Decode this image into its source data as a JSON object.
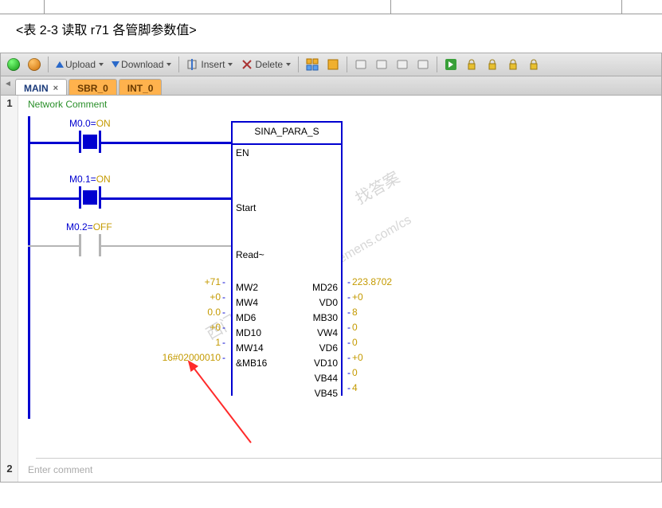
{
  "doc_caption": "<表 2-3 读取 r71 各管脚参数值>",
  "toolbar": {
    "upload": "Upload",
    "download": "Download",
    "insert": "Insert",
    "delete": "Delete"
  },
  "tabs": {
    "t0": "MAIN",
    "t1": "SBR_0",
    "t2": "INT_0"
  },
  "network1": {
    "num": "1",
    "comment": "Network Comment",
    "contacts": {
      "c0_addr": "M0.0=",
      "c0_state": "ON",
      "c1_addr": "M0.1=",
      "c1_state": "ON",
      "c2_addr": "M0.2=",
      "c2_state": "OFF"
    },
    "block": {
      "title": "SINA_PARA_S",
      "left_labels": {
        "en": "EN",
        "start": "Start",
        "read": "Read~"
      },
      "left_params": [
        "MW2",
        "MW4",
        "MD6",
        "MD10",
        "MW14",
        "&MB16"
      ],
      "left_vals": [
        "+71",
        "+0",
        "0.0",
        "+0",
        "1",
        "16#02000010"
      ],
      "right_params": [
        "MD26",
        "VD0",
        "MB30",
        "VW4",
        "VD6",
        "VD10",
        "VB44",
        "VB45"
      ],
      "right_vals": [
        "223.8702",
        "+0",
        "8",
        "0",
        "0",
        "+0",
        "0",
        "4"
      ]
    }
  },
  "network2": {
    "num": "2",
    "comment": "Enter comment"
  },
  "watermarks": {
    "w1": "找答案",
    "w2": "industry.siemens.com/cs",
    "w3": "西门子工业"
  }
}
